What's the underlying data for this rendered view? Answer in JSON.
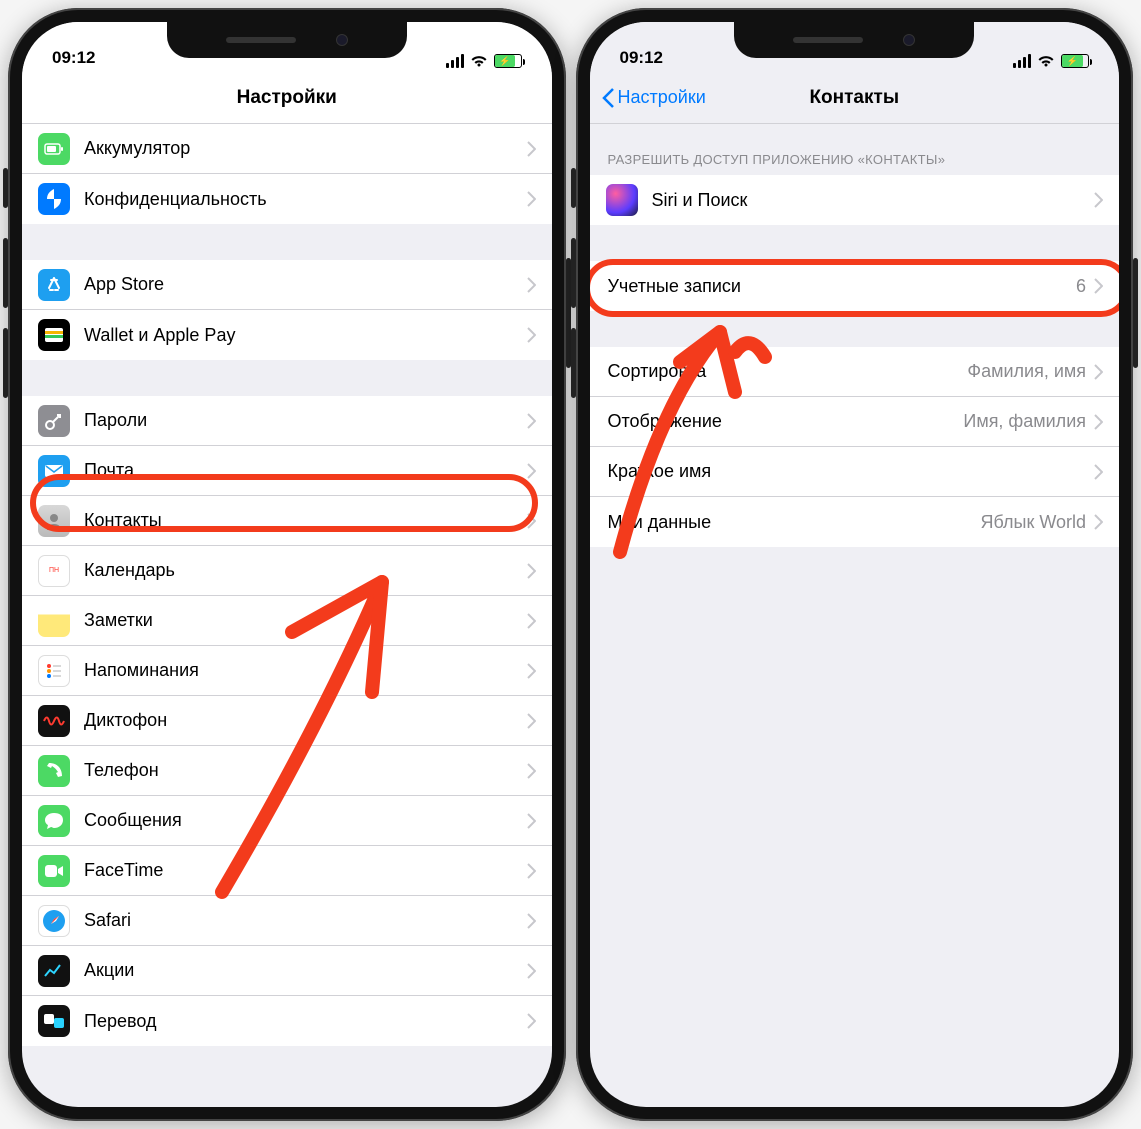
{
  "status": {
    "time": "09:12"
  },
  "phone1": {
    "title": "Настройки",
    "groups": [
      {
        "rows": [
          {
            "icon": "battery",
            "label": "Аккумулятор"
          },
          {
            "icon": "privacy",
            "label": "Конфиденциальность"
          }
        ]
      },
      {
        "rows": [
          {
            "icon": "appstore",
            "label": "App Store"
          },
          {
            "icon": "wallet",
            "label": "Wallet и Apple Pay"
          }
        ]
      },
      {
        "rows": [
          {
            "icon": "passwords",
            "label": "Пароли"
          },
          {
            "icon": "mail",
            "label": "Почта"
          },
          {
            "icon": "contacts",
            "label": "Контакты"
          },
          {
            "icon": "calendar",
            "label": "Календарь"
          },
          {
            "icon": "notes",
            "label": "Заметки"
          },
          {
            "icon": "reminders",
            "label": "Напоминания"
          },
          {
            "icon": "voicememos",
            "label": "Диктофон"
          },
          {
            "icon": "phone",
            "label": "Телефон"
          },
          {
            "icon": "messages",
            "label": "Сообщения"
          },
          {
            "icon": "facetime",
            "label": "FaceTime"
          },
          {
            "icon": "safari",
            "label": "Safari"
          },
          {
            "icon": "stocks",
            "label": "Акции"
          },
          {
            "icon": "translate",
            "label": "Перевод"
          }
        ]
      }
    ]
  },
  "phone2": {
    "back": "Настройки",
    "title": "Контакты",
    "sectionHeader": "РАЗРЕШИТЬ ДОСТУП ПРИЛОЖЕНИЮ «КОНТАКТЫ»",
    "rows": {
      "siri": "Siri и Поиск",
      "accounts_label": "Учетные записи",
      "accounts_value": "6",
      "sort_label": "Сортировка",
      "sort_value": "Фамилия, имя",
      "display_label": "Отображение",
      "display_value": "Имя, фамилия",
      "shortname_label": "Краткое имя",
      "mydata_label": "Мои данные",
      "mydata_value": "Яблык World"
    }
  }
}
